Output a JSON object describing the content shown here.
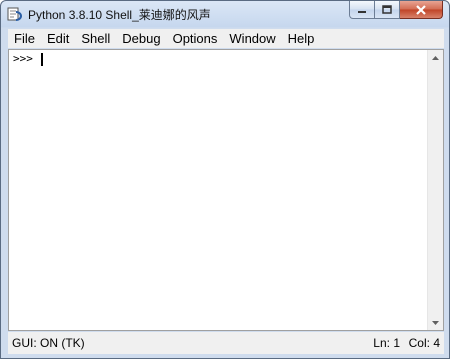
{
  "window": {
    "title": "Python 3.8.10 Shell_莱迪娜的风声"
  },
  "menu": [
    "File",
    "Edit",
    "Shell",
    "Debug",
    "Options",
    "Window",
    "Help"
  ],
  "shell": {
    "prompt": ">>>"
  },
  "status": {
    "gui": "GUI: ON (TK)",
    "line": "Ln: 1",
    "col": "Col: 4"
  },
  "icons": {
    "app": "python-idle-icon",
    "minimize": "minimize-icon",
    "maximize": "maximize-icon",
    "close": "close-icon",
    "scroll_up": "scroll-up-arrow-icon",
    "scroll_down": "scroll-down-arrow-icon"
  },
  "colors": {
    "close_button": "#c04326",
    "title_bar": "#c6d7ee"
  }
}
